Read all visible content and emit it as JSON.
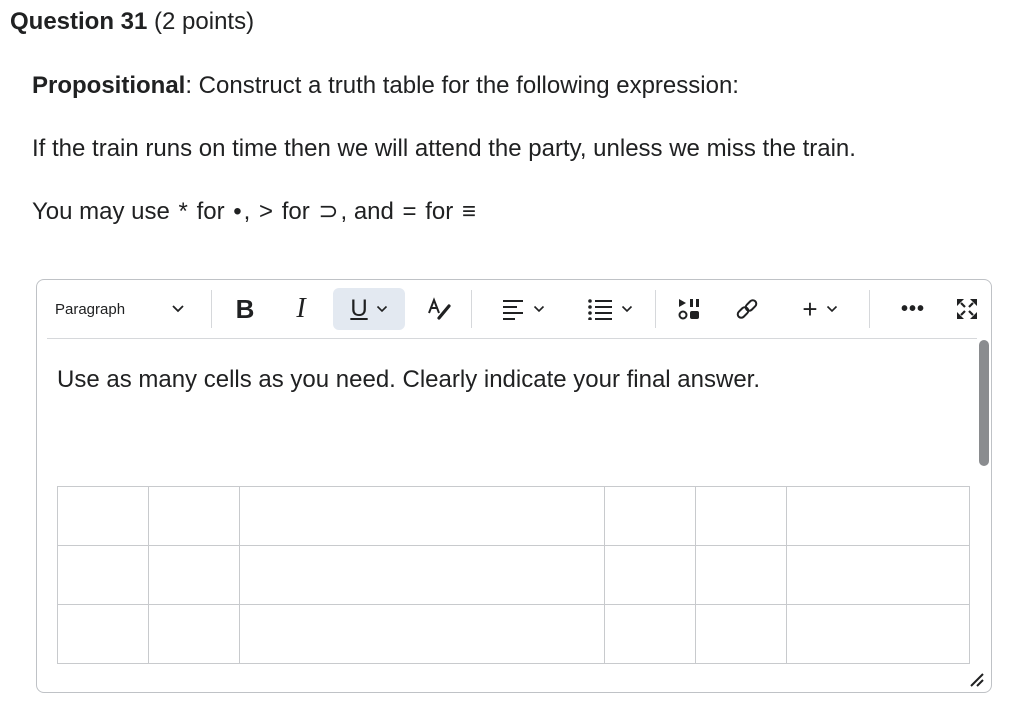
{
  "question": {
    "number_label": "Question 31",
    "points_label": "(2 points)"
  },
  "prompt": {
    "line1_bold": "Propositional",
    "line1_rest": ": Construct a truth table for the following expression:",
    "line2": "If the train runs on time then we will attend the party, unless we miss the train.",
    "line3": {
      "part1": "You may use",
      "sym1": "*",
      "part2": "for",
      "sym2": "•",
      "part3": ",",
      "sym3": ">",
      "part4": "for",
      "sym4": "⊃",
      "part5": ",",
      "part6": "and",
      "sym5": "=",
      "part7": "for",
      "sym6": "≡"
    }
  },
  "toolbar": {
    "paragraph_label": "Paragraph",
    "bold_label": "B",
    "italic_label": "I",
    "underline_label": "U",
    "insert_label": "+",
    "more_label": "•••",
    "icons": {
      "paragraph_chevron": "chevron-down-icon",
      "format": "format-painter-icon",
      "align": "align-left-icon",
      "list": "bullet-list-icon",
      "media": "insert-media-icon",
      "link": "link-icon",
      "fullscreen": "fullscreen-icon"
    }
  },
  "editor": {
    "content_text": "Use as many cells as you need. Clearly indicate your final answer.",
    "active_color": "#e3e9f1",
    "border_color": "#bfc2c6"
  }
}
